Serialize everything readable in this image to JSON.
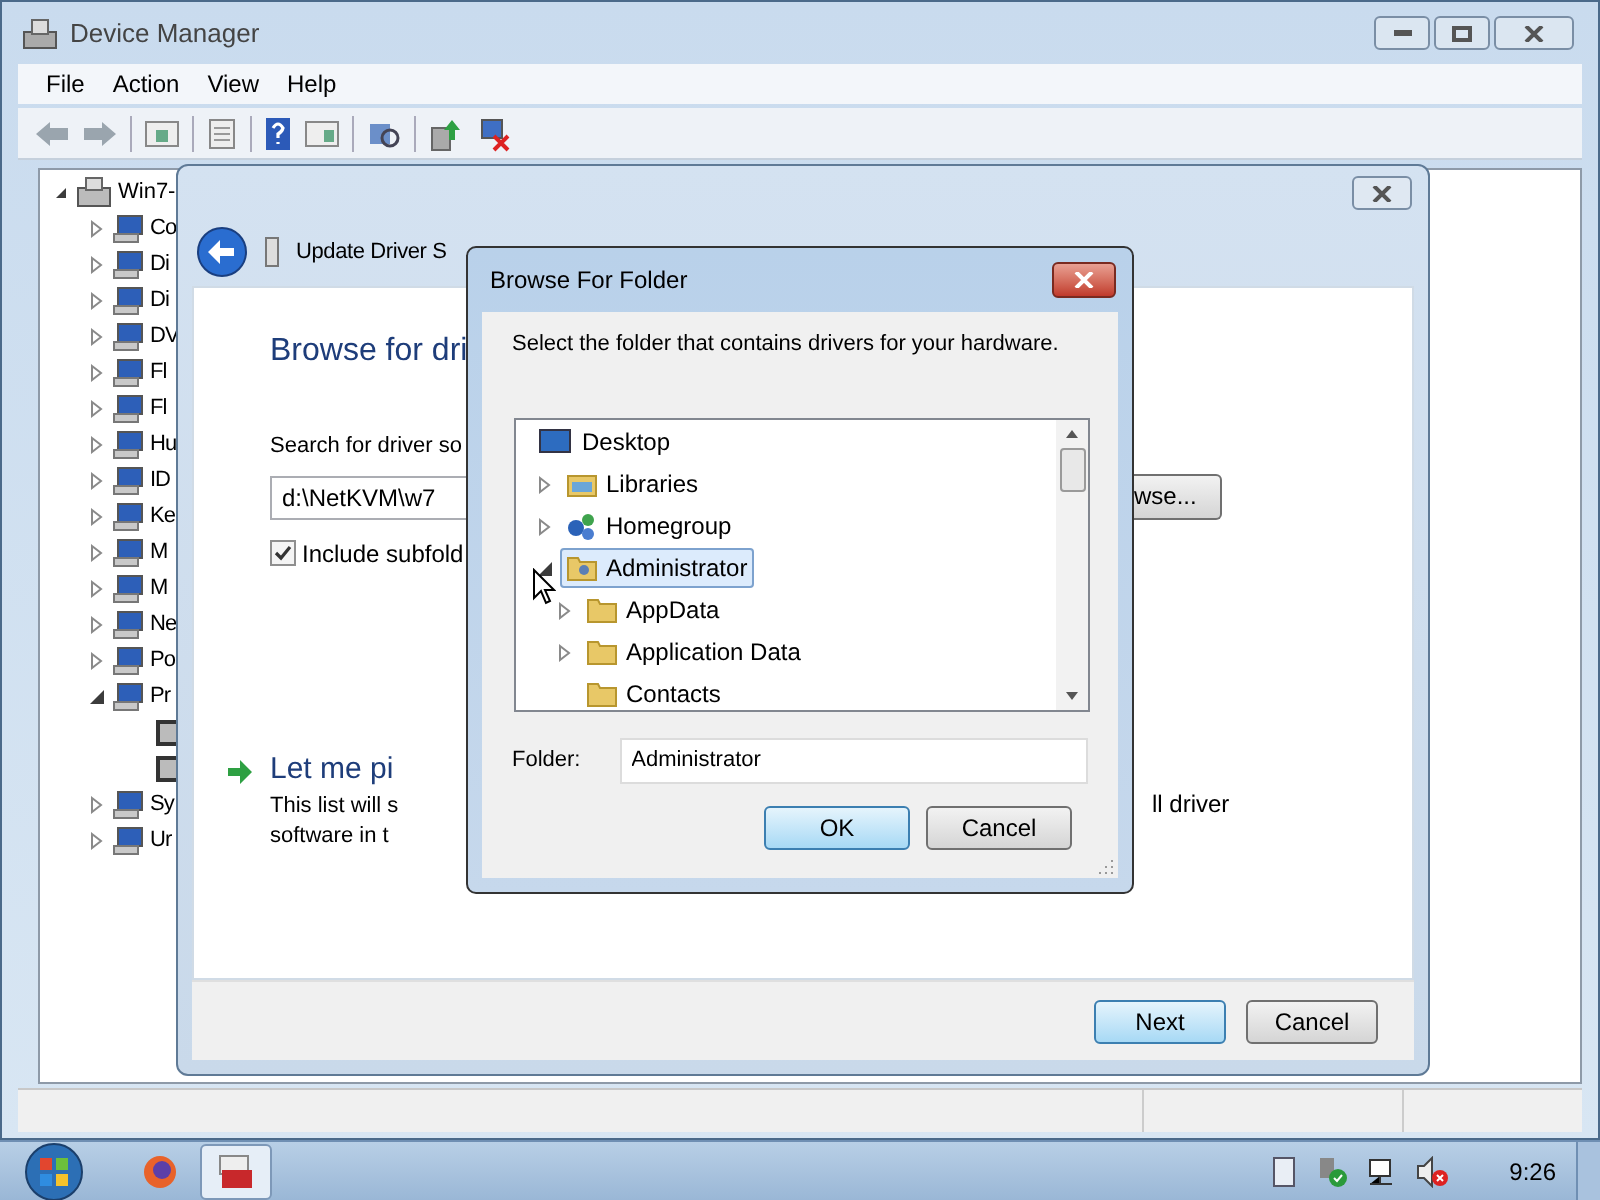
{
  "device_manager": {
    "title": "Device Manager",
    "menu": [
      {
        "label": "File"
      },
      {
        "label": "Action"
      },
      {
        "label": "View"
      },
      {
        "label": "Help"
      }
    ],
    "tree": {
      "label": "Win7-",
      "expanded": true,
      "children": [
        {
          "label": "Co",
          "expandable": true,
          "expanded": false
        },
        {
          "label": "Di",
          "expandable": true,
          "expanded": false
        },
        {
          "label": "Di",
          "expandable": true,
          "expanded": false
        },
        {
          "label": "DV",
          "expandable": true,
          "expanded": false
        },
        {
          "label": "Fl",
          "expandable": true,
          "expanded": false
        },
        {
          "label": "Fl",
          "expandable": true,
          "expanded": false
        },
        {
          "label": "Hu",
          "expandable": true,
          "expanded": false
        },
        {
          "label": "ID",
          "expandable": true,
          "expanded": false
        },
        {
          "label": "Ke",
          "expandable": true,
          "expanded": false
        },
        {
          "label": "M",
          "expandable": true,
          "expanded": false
        },
        {
          "label": "M",
          "expandable": true,
          "expanded": false
        },
        {
          "label": "Ne",
          "expandable": true,
          "expanded": false
        },
        {
          "label": "Po",
          "expandable": true,
          "expanded": false
        },
        {
          "label": "Pr",
          "expandable": true,
          "expanded": true,
          "children": [
            {
              "kind": "processor"
            },
            {
              "kind": "processor"
            }
          ]
        },
        {
          "label": "Sy",
          "expandable": true,
          "expanded": false
        },
        {
          "label": "Ur",
          "expandable": true,
          "expanded": false
        }
      ]
    }
  },
  "wizard": {
    "title": "Update Driver S",
    "heading": "Browse for dri",
    "search_label": "Search for driver so",
    "path": {
      "value": "d:\\NetKVM\\w7"
    },
    "browse_button": "wse...",
    "include_subfolders": {
      "label": "Include subfold",
      "checked": true
    },
    "pick_link": "Let me pi",
    "description_lines": [
      "This list will s",
      "software in t"
    ],
    "description_right": "ll driver",
    "buttons": [
      {
        "label": "Next",
        "default": true
      },
      {
        "label": "Cancel",
        "default": false
      }
    ]
  },
  "browse_dialog": {
    "title": "Browse For Folder",
    "instruction": "Select the folder that contains drivers for your hardware.",
    "tree": {
      "label": "Desktop",
      "selected": false,
      "children": [
        {
          "label": "Libraries",
          "expandable": true,
          "expanded": false,
          "selected": false
        },
        {
          "label": "Homegroup",
          "expandable": true,
          "expanded": false,
          "selected": false
        },
        {
          "label": "Administrator",
          "expandable": true,
          "expanded": true,
          "selected": true,
          "children": [
            {
              "label": "AppData",
              "expandable": true,
              "expanded": false,
              "selected": false
            },
            {
              "label": "Application Data",
              "expandable": true,
              "expanded": false,
              "selected": false
            },
            {
              "label": "Contacts",
              "expandable": false,
              "selected": false
            }
          ]
        }
      ]
    },
    "folder": {
      "label": "Folder:",
      "value": "Administrator"
    },
    "buttons": [
      {
        "label": "OK",
        "default": true
      },
      {
        "label": "Cancel",
        "default": false
      }
    ]
  },
  "taskbar": {
    "items": [
      {
        "kind": "browser",
        "active": false
      },
      {
        "kind": "device-manager",
        "active": true
      }
    ],
    "clock": "9:26"
  }
}
